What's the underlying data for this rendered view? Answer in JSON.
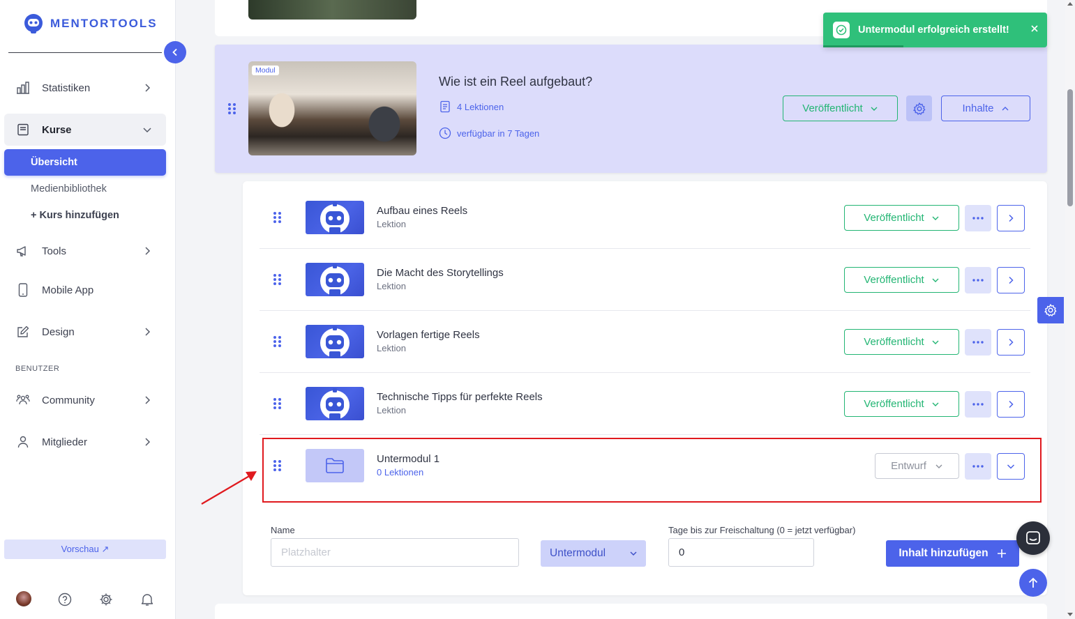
{
  "app": {
    "brand": "MENTORTOOLS"
  },
  "sidebar": {
    "items": [
      {
        "label": "Statistiken",
        "icon": "bar-chart-icon"
      },
      {
        "label": "Kurse",
        "icon": "book-icon"
      },
      {
        "label": "Tools",
        "icon": "megaphone-icon"
      },
      {
        "label": "Mobile App",
        "icon": "phone-icon"
      },
      {
        "label": "Design",
        "icon": "edit-icon"
      },
      {
        "label": "Community",
        "icon": "people-icon"
      },
      {
        "label": "Mitglieder",
        "icon": "user-icon"
      }
    ],
    "kurse_sub": [
      "Übersicht",
      "Medienbibliothek",
      "+ Kurs hinzufügen"
    ],
    "section_benutzer": "BENUTZER",
    "preview_label": "Vorschau ↗"
  },
  "toast": {
    "message": "Untermodul erfolgreich erstellt!"
  },
  "module": {
    "badge": "Modul",
    "title": "Wie ist ein Reel aufgebaut?",
    "lessons_count": "4 Lektionen",
    "availability": "verfügbar in 7 Tagen",
    "status_label": "Veröffentlicht",
    "contents_label": "Inhalte"
  },
  "lessons": [
    {
      "title": "Aufbau eines Reels",
      "type": "Lektion",
      "status": "Veröffentlicht"
    },
    {
      "title": "Die Macht des Storytellings",
      "type": "Lektion",
      "status": "Veröffentlicht"
    },
    {
      "title": "Vorlagen fertige Reels",
      "type": "Lektion",
      "status": "Veröffentlicht"
    },
    {
      "title": "Technische Tipps für perfekte Reels",
      "type": "Lektion",
      "status": "Veröffentlicht"
    },
    {
      "title": "Untermodul 1",
      "type": "0 Lektionen",
      "status": "Entwurf"
    }
  ],
  "form": {
    "name_label": "Name",
    "name_placeholder": "Platzhalter",
    "type_value": "Untermodul",
    "days_label": "Tage bis zur Freischaltung (0 = jetzt verfügbar)",
    "days_value": "0",
    "submit_label": "Inhalt hinzufügen"
  },
  "colors": {
    "accent": "#4c63ea",
    "success": "#22b573",
    "highlight": "#e0191e"
  }
}
